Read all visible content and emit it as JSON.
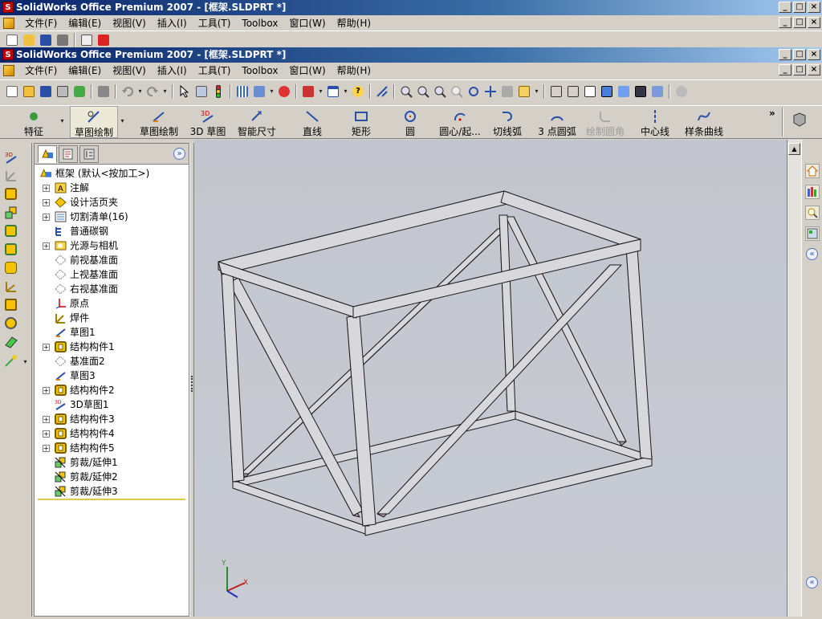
{
  "window": {
    "title_back": "SolidWorks Office Premium 2007 - [框架.SLDPRT *]",
    "title_front": "SolidWorks Office Premium 2007 - [框架.SLDPRT *]",
    "min": "_",
    "max": "□",
    "close": "×"
  },
  "menu": {
    "items": [
      "文件(F)",
      "编辑(E)",
      "视图(V)",
      "插入(I)",
      "工具(T)",
      "Toolbox",
      "窗口(W)",
      "帮助(H)"
    ]
  },
  "command_manager": {
    "items": [
      {
        "label": "特征",
        "icon": "features-icon"
      },
      {
        "label": "草图绘制",
        "icon": "sketch-icon"
      },
      {
        "label": "草图绘制",
        "icon": "sketch-draw-icon"
      },
      {
        "label": "3D 草图",
        "icon": "3d-sketch-icon"
      },
      {
        "label": "智能尺寸",
        "icon": "smart-dimension-icon"
      },
      {
        "label": "直线",
        "icon": "line-icon"
      },
      {
        "label": "矩形",
        "icon": "rectangle-icon"
      },
      {
        "label": "圆",
        "icon": "circle-icon"
      },
      {
        "label": "圆心/起...",
        "icon": "centerpoint-arc-icon"
      },
      {
        "label": "切线弧",
        "icon": "tangent-arc-icon"
      },
      {
        "label": "3 点圆弧",
        "icon": "3point-arc-icon"
      },
      {
        "label": "绘制圆角",
        "icon": "sketch-fillet-icon",
        "disabled": true
      },
      {
        "label": "中心线",
        "icon": "centerline-icon"
      },
      {
        "label": "样条曲线",
        "icon": "spline-icon"
      }
    ],
    "more": "»"
  },
  "feature_manager": {
    "expand": "»",
    "root": "框架  (默认<按加工>)",
    "items": [
      {
        "label": "注解",
        "icon": "annotations-icon",
        "expandable": true
      },
      {
        "label": "设计活页夹",
        "icon": "design-binder-icon",
        "expandable": true
      },
      {
        "label": "切割清单(16)",
        "icon": "cut-list-icon",
        "expandable": true
      },
      {
        "label": "普通碳钢",
        "icon": "material-icon",
        "expandable": false
      },
      {
        "label": "光源与相机",
        "icon": "lights-cameras-icon",
        "expandable": true
      },
      {
        "label": "前视基准面",
        "icon": "plane-icon",
        "expandable": false
      },
      {
        "label": "上视基准面",
        "icon": "plane-icon",
        "expandable": false
      },
      {
        "label": "右视基准面",
        "icon": "plane-icon",
        "expandable": false
      },
      {
        "label": "原点",
        "icon": "origin-icon",
        "expandable": false
      },
      {
        "label": "焊件",
        "icon": "weldment-icon",
        "expandable": false
      },
      {
        "label": "草图1",
        "icon": "sketch-icon",
        "expandable": false
      },
      {
        "label": "结构构件1",
        "icon": "structural-member-icon",
        "expandable": true
      },
      {
        "label": "基准面2",
        "icon": "plane-icon",
        "expandable": false
      },
      {
        "label": "草图3",
        "icon": "sketch-icon",
        "expandable": false
      },
      {
        "label": "结构构件2",
        "icon": "structural-member-icon",
        "expandable": true
      },
      {
        "label": "3D草图1",
        "icon": "3d-sketch-icon",
        "expandable": false
      },
      {
        "label": "结构构件3",
        "icon": "structural-member-icon",
        "expandable": true
      },
      {
        "label": "结构构件4",
        "icon": "structural-member-icon",
        "expandable": true
      },
      {
        "label": "结构构件5",
        "icon": "structural-member-icon",
        "expandable": true
      },
      {
        "label": "剪裁/延伸1",
        "icon": "trim-extend-icon",
        "expandable": false
      },
      {
        "label": "剪裁/延伸2",
        "icon": "trim-extend-icon",
        "expandable": false
      },
      {
        "label": "剪裁/延伸3",
        "icon": "trim-extend-icon",
        "expandable": false
      }
    ]
  },
  "triad": {
    "x": "X",
    "y": "Y"
  },
  "colors": {
    "title_start": "#0a246a",
    "title_end": "#a6caf0",
    "face_top": "#d8d8dc",
    "face_side": "#a898aa",
    "viewport_bg": "#c6c9d1"
  }
}
